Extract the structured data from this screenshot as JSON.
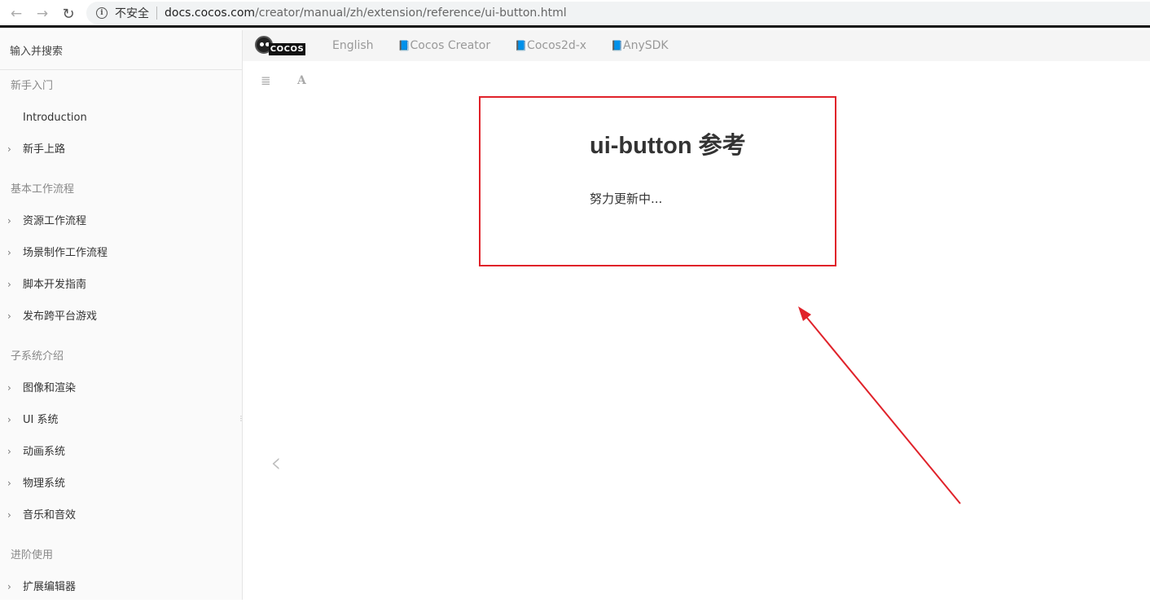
{
  "browser": {
    "insecure_label": "不安全",
    "url_host": "docs.cocos.com",
    "url_path": "/creator/manual/zh/extension/reference/ui-button.html",
    "icons": {
      "back": "back-arrow-icon",
      "forward": "forward-arrow-icon",
      "reload": "reload-icon",
      "info": "info-icon"
    }
  },
  "sidebar": {
    "search_placeholder": "输入并搜索",
    "sections": [
      {
        "title": "新手入门",
        "items": [
          {
            "label": "Introduction",
            "expandable": false
          },
          {
            "label": "新手上路",
            "expandable": true
          }
        ]
      },
      {
        "title": "基本工作流程",
        "items": [
          {
            "label": "资源工作流程",
            "expandable": true
          },
          {
            "label": "场景制作工作流程",
            "expandable": true
          },
          {
            "label": "脚本开发指南",
            "expandable": true
          },
          {
            "label": "发布跨平台游戏",
            "expandable": true
          }
        ]
      },
      {
        "title": "子系统介绍",
        "items": [
          {
            "label": "图像和渲染",
            "expandable": true
          },
          {
            "label": "UI 系统",
            "expandable": true
          },
          {
            "label": "动画系统",
            "expandable": true
          },
          {
            "label": "物理系统",
            "expandable": true
          },
          {
            "label": "音乐和音效",
            "expandable": true
          }
        ]
      },
      {
        "title": "进阶使用",
        "items": [
          {
            "label": "扩展编辑器",
            "expandable": true
          }
        ]
      }
    ]
  },
  "header": {
    "logo_text": "COCOS",
    "links": [
      {
        "label": "English",
        "book": false
      },
      {
        "label": "Cocos Creator",
        "book": true
      },
      {
        "label": "Cocos2d-x",
        "book": true
      },
      {
        "label": "AnySDK",
        "book": true
      }
    ]
  },
  "page": {
    "title": "ui-button 参考",
    "body": "努力更新中..."
  },
  "colors": {
    "annotation": "#e0222a"
  }
}
